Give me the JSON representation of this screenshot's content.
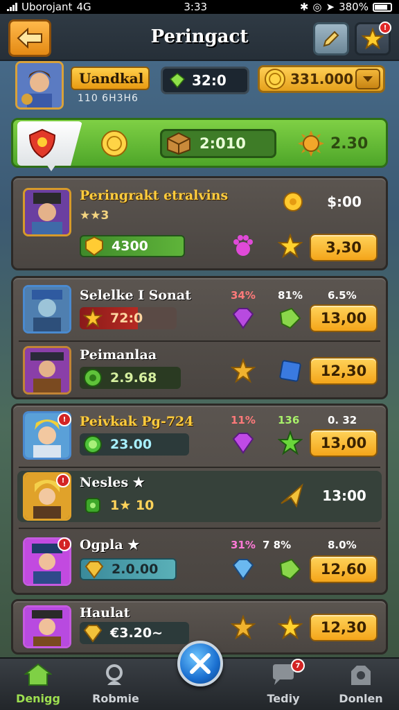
{
  "status_bar": {
    "carrier": "Uborojant",
    "network": "4G",
    "time": "3:33",
    "battery": "380%"
  },
  "header": {
    "title": "Peringact"
  },
  "profile": {
    "name": "Uandkal",
    "subtitle": "110 6H3H6",
    "gems": "32:0",
    "coins": "331.000"
  },
  "banner": {
    "coin_value": "",
    "chest_value": "2:010",
    "sun_value": "2.30"
  },
  "cards": [
    {
      "rows": [
        {
          "name": "Peringrakt etralvins",
          "rating": "★★3",
          "bar_value": "4300",
          "top_right": "$:00",
          "price": "3,30"
        }
      ]
    },
    {
      "rows": [
        {
          "name": "Selelke I Sonat",
          "bar_value": "72:0",
          "stat1": "34%",
          "stat2": "81%",
          "stat3": "6.5%",
          "price": "13,00"
        },
        {
          "name": "Peimanlaa",
          "bar_value": "2.9.68",
          "price": "12,30"
        }
      ]
    },
    {
      "rows": [
        {
          "name": "Peivkak Pg-724",
          "bar_value": "23.00",
          "stat1": "11%",
          "stat2": "136",
          "stat3": "0. 32",
          "price": "13,00"
        },
        {
          "name": "Nesles ★",
          "bar_value": "1★ 10",
          "price": "13:00"
        },
        {
          "name": "Ogpla ★",
          "bar_value": "2.0.00",
          "stat1": "31%",
          "stat2": "7 8%",
          "stat3": "8.0%",
          "price": "12,60"
        }
      ]
    },
    {
      "rows": [
        {
          "name": "Haulat",
          "bar_value": "€3.20~",
          "price": "12,30"
        }
      ]
    }
  ],
  "bottom_nav": {
    "items": [
      {
        "label": "Denigg",
        "icon": "home-icon"
      },
      {
        "label": "Robmie",
        "icon": "search-icon"
      },
      {
        "label": "Tediy",
        "icon": "chat-icon",
        "badge": "7"
      },
      {
        "label": "Donlen",
        "icon": "bag-icon"
      }
    ],
    "center_icon": "close-icon"
  }
}
